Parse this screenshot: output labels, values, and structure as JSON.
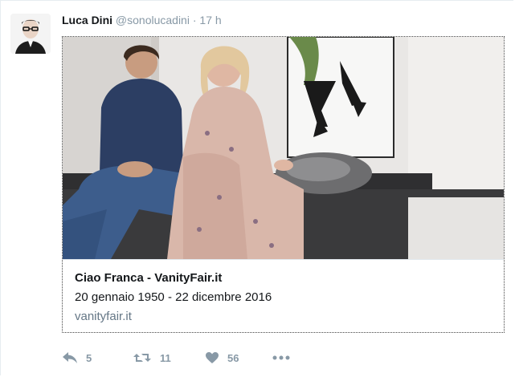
{
  "tweet": {
    "fullname": "Luca Dini",
    "username": "@sonolucadini",
    "separator": "·",
    "time": "17 h"
  },
  "card": {
    "title": "Ciao Franca - VanityFair.it",
    "description": "20 gennaio 1950 - 22 dicembre 2016",
    "domain": "vanityfair.it"
  },
  "actions": {
    "reply_count": "5",
    "retweet_count": "11",
    "like_count": "56"
  },
  "icons": {
    "reply": "reply-icon",
    "retweet": "retweet-icon",
    "like": "heart-icon",
    "more": "more-dots-icon"
  },
  "colors": {
    "muted": "#8899a6",
    "text": "#14171a",
    "domain": "#657786"
  }
}
